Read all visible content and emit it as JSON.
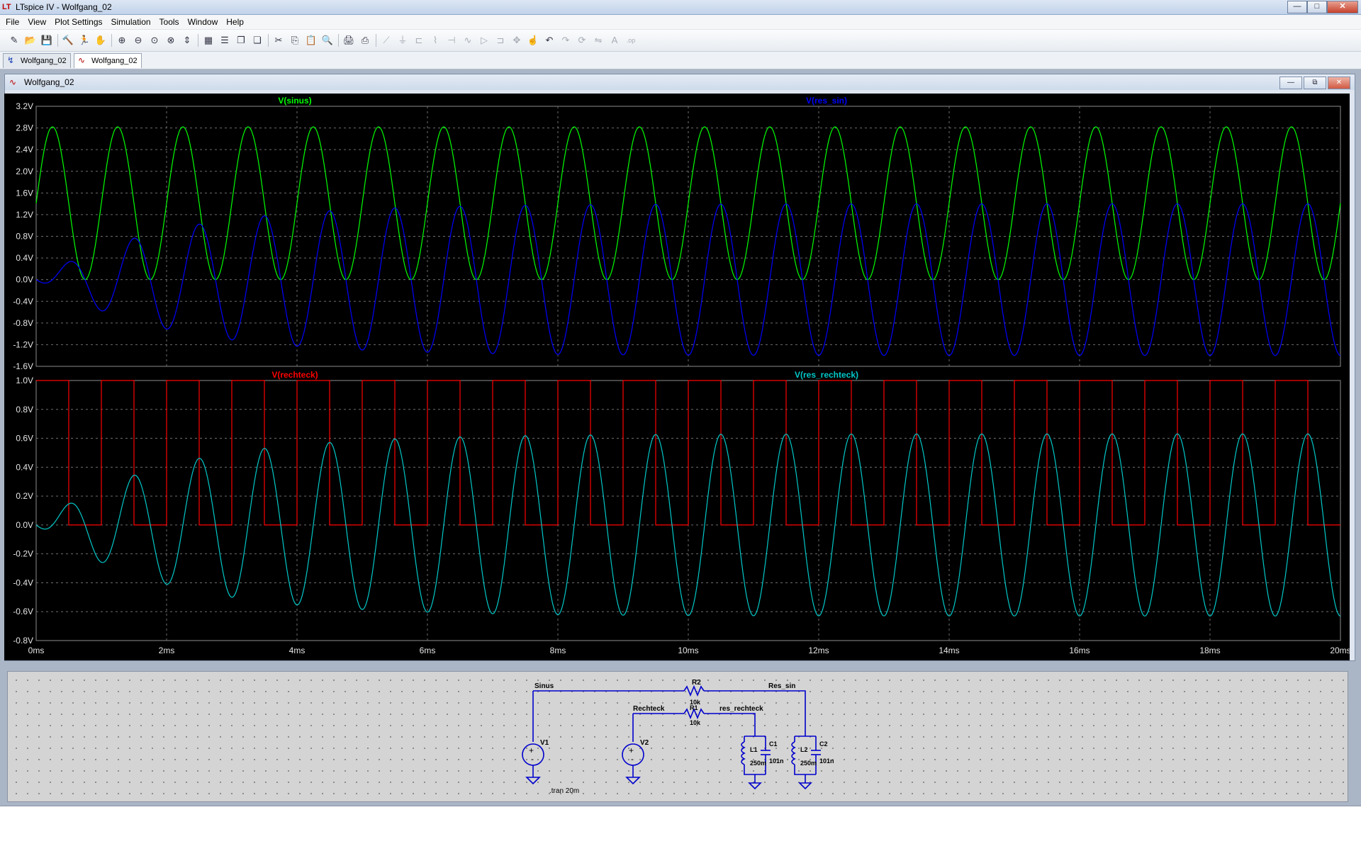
{
  "window": {
    "title": "LTspice IV - Wolfgang_02"
  },
  "menu": [
    "File",
    "View",
    "Plot Settings",
    "Simulation",
    "Tools",
    "Window",
    "Help"
  ],
  "toolbar_icons": [
    "new-schematic-icon",
    "open-icon",
    "save-icon",
    "control-panel-icon",
    "run-icon",
    "halt-icon",
    "zoom-in-icon",
    "zoom-out-icon",
    "zoom-fit-icon",
    "zoom-cancel-icon",
    "autorange-icon",
    "grid-icon",
    "tile-horizontal-icon",
    "tile-vertical-icon",
    "cascade-icon",
    "cut-icon",
    "copy-icon",
    "paste-icon",
    "find-icon",
    "print-icon",
    "print-setup-icon",
    "wire-icon",
    "ground-icon",
    "label-icon",
    "resistor-icon",
    "capacitor-icon",
    "inductor-icon",
    "diode-icon",
    "component-icon",
    "move-icon",
    "drag-icon",
    "undo-icon",
    "redo-icon",
    "rotate-icon",
    "mirror-icon",
    "text-icon",
    "spice-directive-icon"
  ],
  "tabs": [
    {
      "label": "Wolfgang_02",
      "icon": "schematic-icon"
    },
    {
      "label": "Wolfgang_02",
      "icon": "waveform-icon"
    }
  ],
  "plot_window": {
    "title": "Wolfgang_02"
  },
  "chart_data": [
    {
      "type": "line",
      "title": "",
      "xlabel": "",
      "ylabel": "",
      "x_ticks": [
        "0ms",
        "2ms",
        "4ms",
        "6ms",
        "8ms",
        "10ms",
        "12ms",
        "14ms",
        "16ms",
        "18ms",
        "20ms"
      ],
      "xlim": [
        0,
        20
      ],
      "y_ticks": [
        "3.2V",
        "2.8V",
        "2.4V",
        "2.0V",
        "1.6V",
        "1.2V",
        "0.8V",
        "0.4V",
        "0.0V",
        "-0.4V",
        "-0.8V",
        "-1.2V",
        "-1.6V"
      ],
      "ylim": [
        -1.6,
        3.2
      ],
      "grid": true,
      "series": [
        {
          "name": "V(sinus)",
          "color": "#00ff00",
          "frequency_hz": 1000,
          "offset_v": 1.41,
          "amplitude_v": 1.41,
          "phase": "starts at 1.41V rising"
        },
        {
          "name": "V(res_sin)",
          "color": "#0000ff",
          "frequency_hz": 1000,
          "steady_state_amplitude_v": 1.4,
          "first_peaks_v": [
            0.18,
            0.65,
            0.92,
            1.12,
            1.22,
            1.3,
            1.35,
            1.38,
            1.4
          ]
        }
      ]
    },
    {
      "type": "line",
      "title": "",
      "xlabel": "",
      "ylabel": "",
      "x_ticks": [
        "0ms",
        "2ms",
        "4ms",
        "6ms",
        "8ms",
        "10ms",
        "12ms",
        "14ms",
        "16ms",
        "18ms",
        "20ms"
      ],
      "xlim": [
        0,
        20
      ],
      "y_ticks": [
        "1.0V",
        "0.8V",
        "0.6V",
        "0.4V",
        "0.2V",
        "0.0V",
        "-0.2V",
        "-0.4V",
        "-0.6V",
        "-0.8V"
      ],
      "ylim": [
        -0.8,
        1.0
      ],
      "grid": true,
      "series": [
        {
          "name": "V(rechteck)",
          "color": "#ff0000",
          "frequency_hz": 1000,
          "low_v": 0.0,
          "high_v": 1.0,
          "first_high_ms": [
            0.0,
            0.5
          ]
        },
        {
          "name": "V(res_rechteck)",
          "color": "#00c8c8",
          "frequency_hz": 1000,
          "steady_state_amplitude_v": 0.63,
          "first_peaks_v": [
            0.14,
            0.33,
            0.45,
            0.52,
            0.56,
            0.59,
            0.61,
            0.62,
            0.63
          ]
        }
      ]
    }
  ],
  "schematic": {
    "net_labels": [
      "Sinus",
      "Res_sin",
      "Rechteck",
      "res_rechteck"
    ],
    "components": [
      {
        "ref": "R2",
        "value": "10k"
      },
      {
        "ref": "R1",
        "value": "10k"
      },
      {
        "ref": "V1",
        "value": ""
      },
      {
        "ref": "V2",
        "value": ""
      },
      {
        "ref": "L1",
        "value": "250m"
      },
      {
        "ref": "C1",
        "value": "101n"
      },
      {
        "ref": "L2",
        "value": "250m"
      },
      {
        "ref": "C2",
        "value": "101n"
      }
    ],
    "directive": ".tran 20m"
  }
}
